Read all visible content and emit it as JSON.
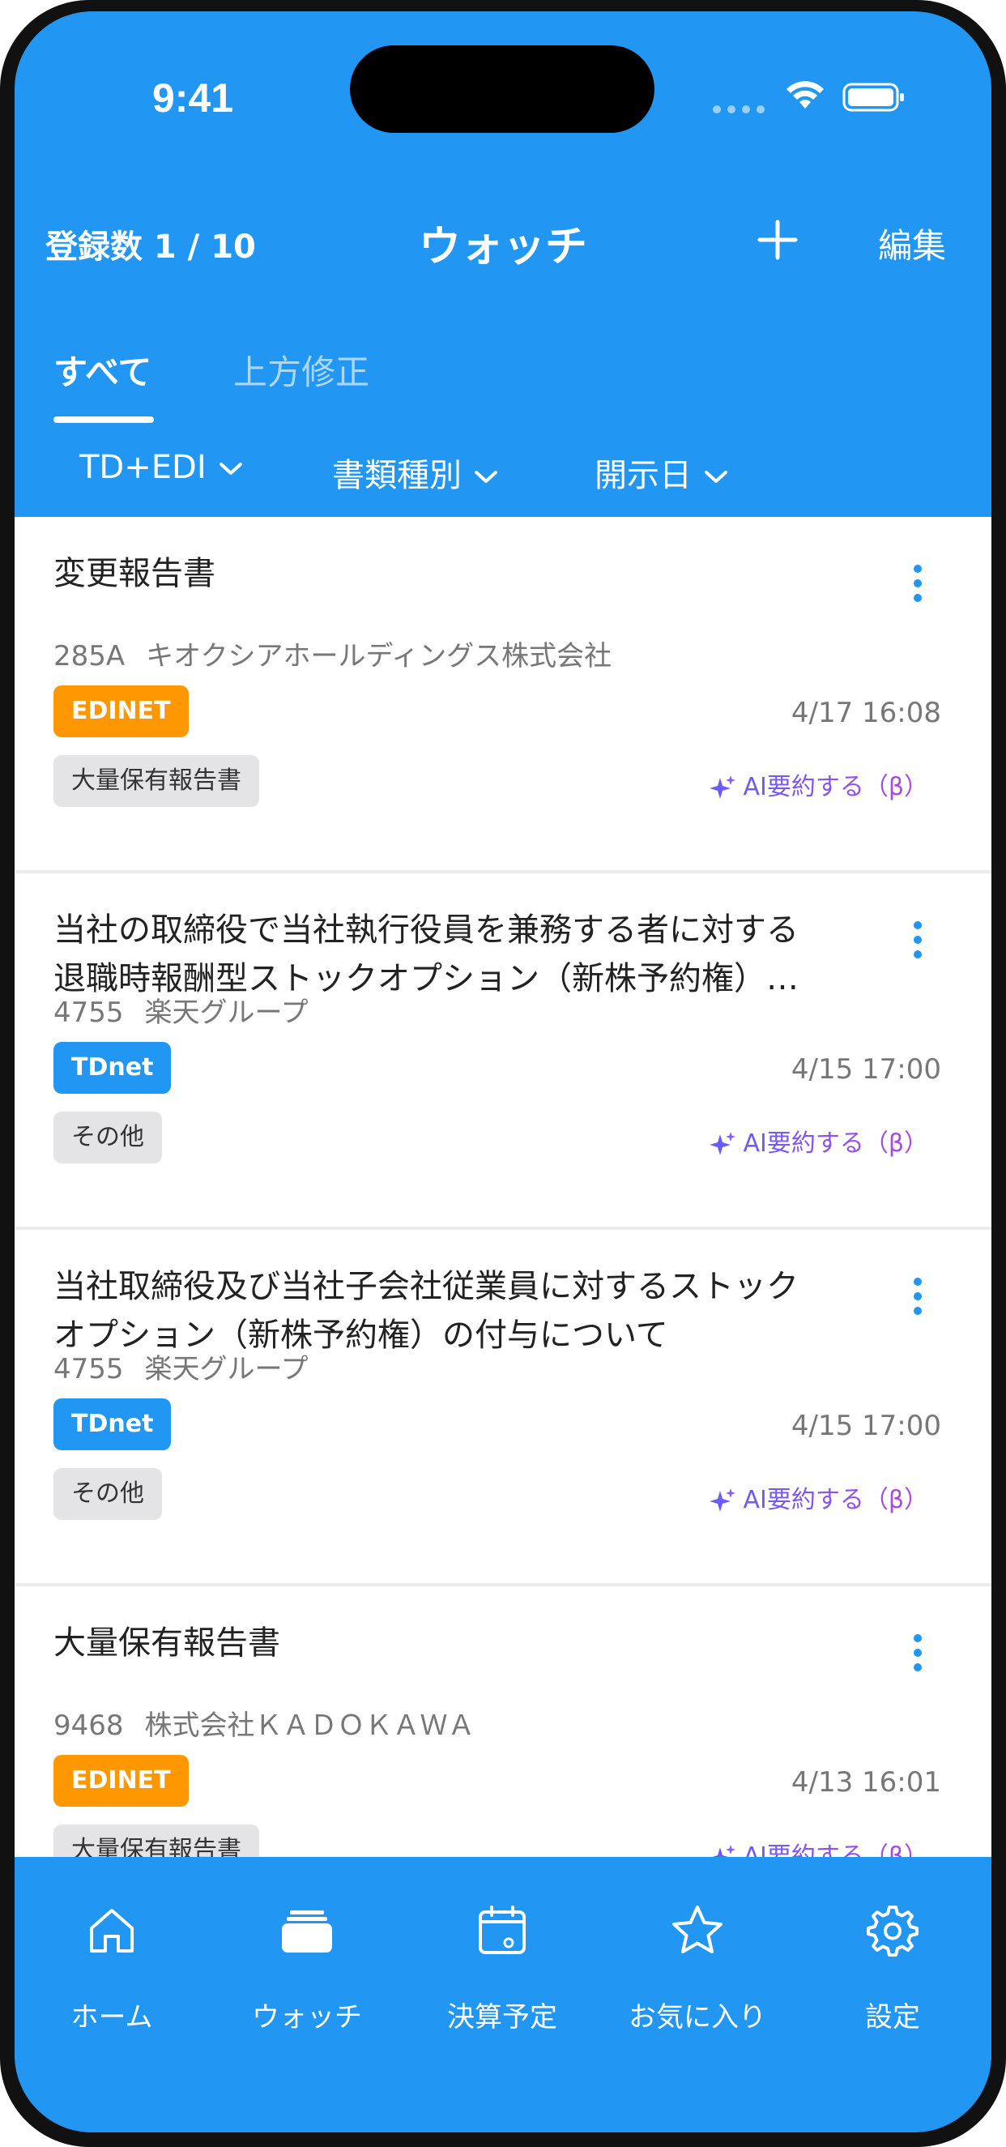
{
  "status_bar": {
    "time": "9:41"
  },
  "header": {
    "count_label": "登録数 1 / 10",
    "title": "ウォッチ",
    "edit_label": "編集"
  },
  "tabs": [
    {
      "label": "すべて"
    },
    {
      "label": "上方修正"
    }
  ],
  "filters": [
    {
      "label": "TD+EDI"
    },
    {
      "label": "書類種別"
    },
    {
      "label": "開示日"
    }
  ],
  "items": [
    {
      "title_lines": [
        "変更報告書"
      ],
      "code": "285A",
      "company": "キオクシアホールディングス株式会社",
      "source": "EDINET",
      "date": "4/17 16:08",
      "doc_type": "大量保有報告書",
      "ai_label": "AI要約する（β）"
    },
    {
      "title_lines": [
        "当社の取締役で当社執行役員を兼務する者に対する",
        "退職時報酬型ストックオプション（新株予約権）…"
      ],
      "code": "4755",
      "company": "楽天グループ",
      "source": "TDnet",
      "date": "4/15 17:00",
      "doc_type": "その他",
      "ai_label": "AI要約する（β）"
    },
    {
      "title_lines": [
        "当社取締役及び当社子会社従業員に対するストック",
        "オプション（新株予約権）の付与について"
      ],
      "code": "4755",
      "company": "楽天グループ",
      "source": "TDnet",
      "date": "4/15 17:00",
      "doc_type": "その他",
      "ai_label": "AI要約する（β）"
    },
    {
      "title_lines": [
        "大量保有報告書"
      ],
      "code": "9468",
      "company": "株式会社ＫＡＤＯＫＡＷＡ",
      "source": "EDINET",
      "date": "4/13 16:01",
      "doc_type": "大量保有報告書",
      "ai_label": "AI要約する（β）"
    }
  ],
  "bottom_nav": [
    {
      "label": "ホーム",
      "icon": "home-icon"
    },
    {
      "label": "ウォッチ",
      "icon": "watch-folder-icon"
    },
    {
      "label": "決算予定",
      "icon": "calendar-icon"
    },
    {
      "label": "お気に入り",
      "icon": "star-icon"
    },
    {
      "label": "設定",
      "icon": "gear-icon"
    }
  ],
  "colors": {
    "primary": "#2196F3",
    "edinet": "#FF9800",
    "tdnet": "#2196F3",
    "ai_start": "#6a5cff",
    "ai_end": "#b048d8"
  }
}
